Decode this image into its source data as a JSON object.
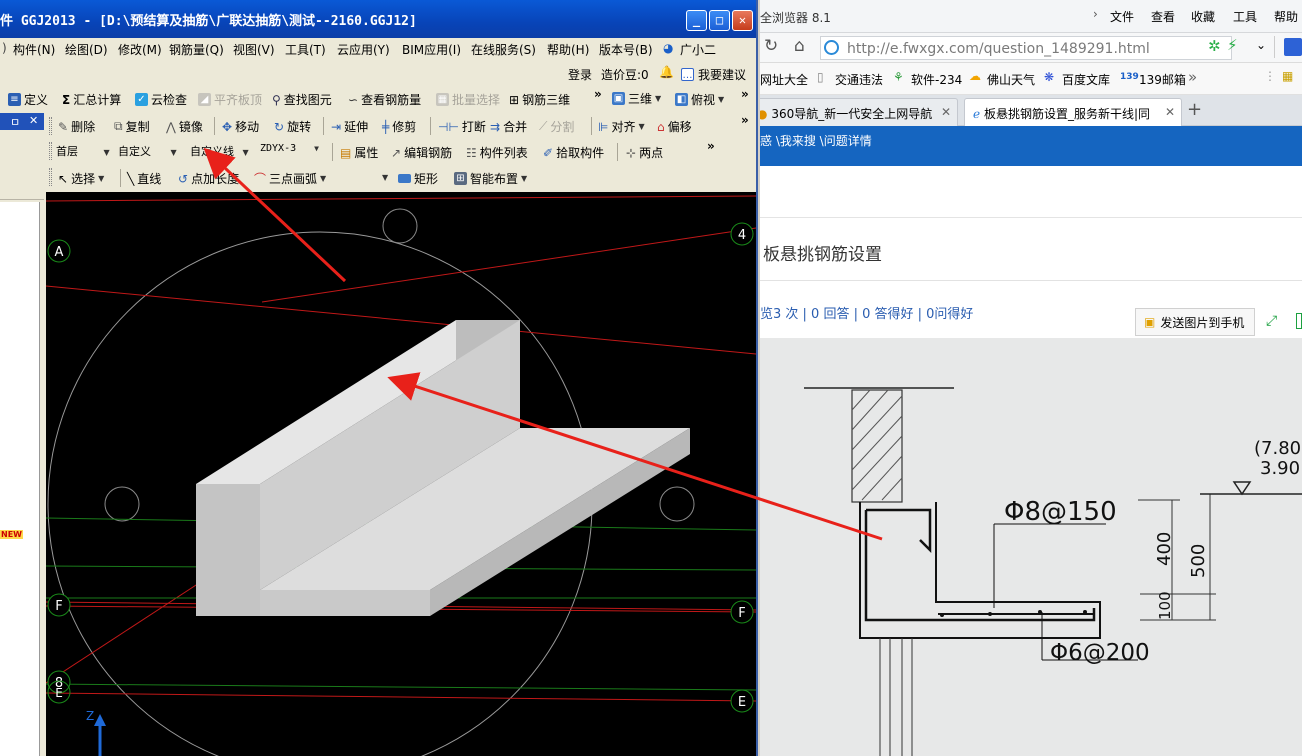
{
  "ggj": {
    "title": "件 GGJ2013 - [D:\\预结算及抽筋\\广联达抽筋\\测试--2160.GGJ12]",
    "window_buttons": {
      "minimize": "_",
      "maximize": "□",
      "close": "✕"
    },
    "menu": [
      "构件(N)",
      "绘图(D)",
      "修改(M)",
      "钢筋量(Q)",
      "视图(V)",
      "工具(T)",
      "云应用(Y)",
      "BIM应用(I)",
      "在线服务(S)",
      "帮助(H)",
      "版本号(B)",
      "广小二"
    ],
    "account": {
      "login": "登录",
      "price_beans": "造价豆:0",
      "suggest": "我要建议"
    },
    "toolbar1": [
      "定义",
      "汇总计算",
      "云检查",
      "平齐板顶",
      "查找图元",
      "查看钢筋量",
      "批量选择",
      "钢筋三维",
      "三维",
      "俯视"
    ],
    "toolbar2": [
      "删除",
      "复制",
      "镜像",
      "移动",
      "旋转",
      "延伸",
      "修剪",
      "打断",
      "合并",
      "分割",
      "对齐",
      "偏移"
    ],
    "toolbar3": {
      "floor": "首层",
      "category": "自定义",
      "type": "自定义线",
      "name": "ZDYX-3",
      "props": "属性",
      "edit_rebar": "编辑钢筋",
      "component_list": "构件列表",
      "pick": "拾取构件",
      "two_points": "两点"
    },
    "toolbar4": [
      "选择",
      "直线",
      "点加长度",
      "三点画弧",
      "矩形",
      "智能布置"
    ],
    "left_panel": {
      "pin": "ㅁ",
      "close": "✕",
      "new_badge": "NEW"
    },
    "axis_labels": {
      "a": "A",
      "four": "4",
      "f_left": "F",
      "f_right": "F",
      "e_right": "E",
      "e_left": "E",
      "eight": "8",
      "z": "Z"
    }
  },
  "browser": {
    "title": "全浏览器 8.1",
    "menu": [
      "文件",
      "查看",
      "收藏",
      "工具",
      "帮助"
    ],
    "url": "http://e.fwxgx.com/question_1489291.html",
    "favorites": [
      "网址大全",
      "交通违法",
      "软件-234",
      "佛山天气",
      "百度文库",
      "139邮箱"
    ],
    "tabs": [
      {
        "label": "360导航_新一代安全上网导航",
        "active": false
      },
      {
        "label": "板悬挑钢筋设置_服务新干线|同",
        "active": true
      }
    ],
    "new_tab": "+",
    "site_nav": "惑 \\我来搜 \\问题详情",
    "question_title": "板悬挑钢筋设置",
    "stats": "览3 次 | 0 回答 | 0 答得好 | 0问得好",
    "send_button": "发送图片到手机"
  },
  "drawing": {
    "rebar_top": "Φ8@150",
    "rebar_bottom": "Φ6@200",
    "elev1": "(7.80",
    "elev2": "3.90",
    "dim400": "400",
    "dim500": "500",
    "dim100": "100"
  },
  "colors": {
    "titlebar": "#0a4fcf",
    "accent": "#1565c0",
    "arrow": "#e8211a"
  }
}
